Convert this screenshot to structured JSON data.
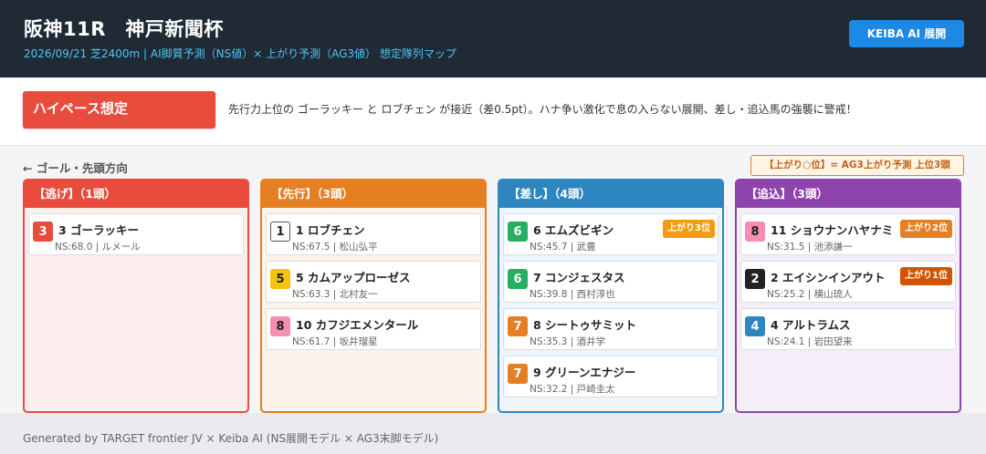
{
  "header": {
    "title": "阪神11R　神戸新聞杯",
    "subtitle": "2026/09/21  芝2400m  |  AI脚質予測（NS値）× 上がり予測（AG3値） 想定隊列マップ",
    "brand_button": "KEIBA AI 展開"
  },
  "pace": {
    "badge": "ハイペース想定",
    "description": "先行力上位の ゴーラッキー と ロブチェン が接近（差0.5pt）。ハナ争い激化で息の入らない展開、差し・追込馬の強襲に警戒！"
  },
  "map": {
    "goal_label": "← ゴール・先頭方向",
    "legend_note": "【上がり○位】= AG3上がり予測 上位3頭"
  },
  "colors": {
    "nige": "#e74c3c",
    "senko": "#e67e22",
    "sashi": "#2e86c1",
    "oikomi": "#8e44ad",
    "agari_1": "#d35400",
    "agari_2": "#e67e22",
    "agari_3": "#f39c12"
  },
  "columns": [
    {
      "header": "【逃げ】（1頭）",
      "horses": [
        {
          "gate": "3",
          "name": "3 ゴーラッキー",
          "meta": "NS:68.0 | ルメール",
          "agari": ""
        }
      ]
    },
    {
      "header": "【先行】（3頭）",
      "horses": [
        {
          "gate": "1",
          "name": "1 ロブチェン",
          "meta": "NS:67.5 | 松山弘平",
          "agari": ""
        },
        {
          "gate": "5",
          "name": "5 カムアップローゼス",
          "meta": "NS:63.3 | 北村友一",
          "agari": ""
        },
        {
          "gate": "8",
          "name": "10 カフジエメンタール",
          "meta": "NS:61.7 | 坂井瑠星",
          "agari": ""
        }
      ]
    },
    {
      "header": "【差し】（4頭）",
      "horses": [
        {
          "gate": "6",
          "name": "6 エムズビギン",
          "meta": "NS:45.7 | 武豊",
          "agari": "上がり3位"
        },
        {
          "gate": "6",
          "name": "7 コンジェスタス",
          "meta": "NS:39.8 | 西村淳也",
          "agari": ""
        },
        {
          "gate": "7",
          "name": "8 シートゥサミット",
          "meta": "NS:35.3 | 酒井学",
          "agari": ""
        },
        {
          "gate": "7",
          "name": "9 グリーンエナジー",
          "meta": "NS:32.2 | 戸崎圭太",
          "agari": ""
        }
      ]
    },
    {
      "header": "【追込】（3頭）",
      "horses": [
        {
          "gate": "8",
          "name": "11 ショウナンハヤナミ",
          "meta": "NS:31.5 | 池添謙一",
          "agari": "上がり2位"
        },
        {
          "gate": "2",
          "name": "2 エイシンインアウト",
          "meta": "NS:25.2 | 横山琉人",
          "agari": "上がり1位"
        },
        {
          "gate": "4",
          "name": "4 アルトラムス",
          "meta": "NS:24.1 | 岩田望来",
          "agari": ""
        }
      ]
    }
  ],
  "footer": {
    "text": "Generated by TARGET frontier JV × Keiba AI (NS展開モデル × AG3末脚モデル)"
  }
}
